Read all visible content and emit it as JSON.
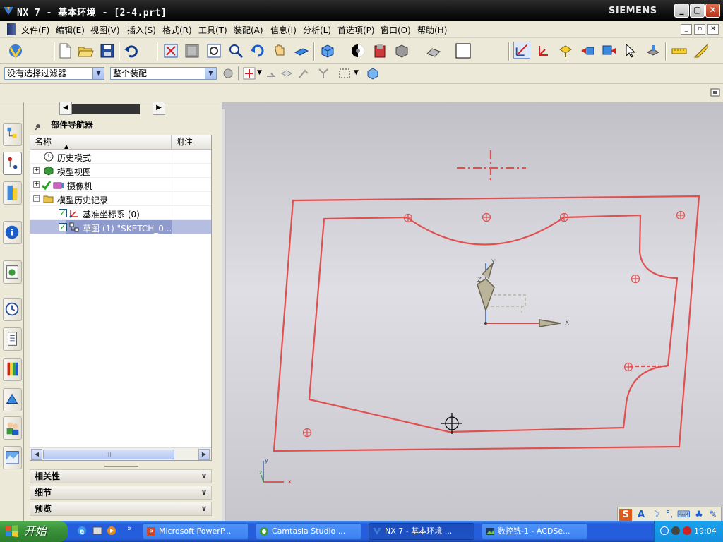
{
  "window": {
    "title": "NX 7 - 基本环境 - [2-4.prt]",
    "brand": "SIEMENS",
    "min_label": "_",
    "max_label": "▢",
    "close_label": "✕"
  },
  "menu": {
    "items": [
      "文件(F)",
      "编辑(E)",
      "视图(V)",
      "插入(S)",
      "格式(R)",
      "工具(T)",
      "装配(A)",
      "信息(I)",
      "分析(L)",
      "首选项(P)",
      "窗口(O)",
      "帮助(H)"
    ]
  },
  "toolbar": {
    "start_label": "开始",
    "selection_filter": "没有选择过滤器",
    "assembly_scope": "整个装配"
  },
  "navigator": {
    "title": "部件导航器",
    "col_name": "名称",
    "col_attach": "附注",
    "sort_icon": "▲",
    "rows": [
      {
        "label": "历史模式",
        "icon": "clock-icon"
      },
      {
        "label": "模型视图",
        "icon": "model-views-icon"
      },
      {
        "label": "摄像机",
        "icon": "camera-icon"
      },
      {
        "label": "模型历史记录",
        "icon": "folder-icon"
      },
      {
        "label": "基准坐标系 (0)",
        "icon": "datum-csys-icon"
      },
      {
        "label": "草图 (1) \"SKETCH_0...",
        "icon": "sketch-icon"
      }
    ],
    "sections": [
      "相关性",
      "细节",
      "预览"
    ],
    "hscroll_thumb": "|||"
  },
  "viewport": {
    "axis_x": "x",
    "axis_y": "y",
    "axis_z": "z",
    "wcs_x": "X",
    "wcs_y": "Y",
    "wcs_z": "Z"
  },
  "taskbar": {
    "start": "开始",
    "tasks": [
      "Microsoft PowerP...",
      "Camtasia Studio ...",
      "NX 7 - 基本环境 ...",
      "数控铣-1 - ACDSe..."
    ],
    "clock": "19:04"
  },
  "colors": {
    "sketch_curve": "#e05050",
    "accent": "#245edc",
    "start_green": "#3a943a"
  }
}
